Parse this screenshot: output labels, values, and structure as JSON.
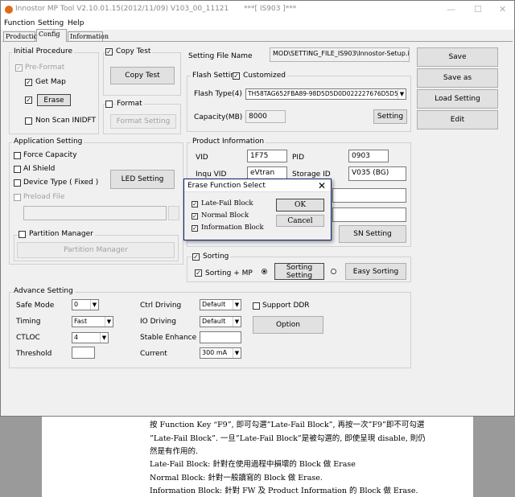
{
  "window": {
    "title": "Innostor MP Tool V2.10.01.15(2012/11/09)   V103_00_11121",
    "title_tag": "***[ IS903 ]***",
    "controls": [
      "—",
      "☐",
      "✕"
    ]
  },
  "menu": [
    "Function",
    "Setting",
    "Help"
  ],
  "tabs": [
    "Production",
    "Config",
    "Information"
  ],
  "initial_procedure": {
    "title": "Initial Procedure",
    "pre_format": "Pre-Format",
    "get_map": "Get Map",
    "erase_button": "Erase",
    "non_scan": "Non Scan INIDFT"
  },
  "copy_test": {
    "title": "Copy Test",
    "button": "Copy Test"
  },
  "format": {
    "title": "Format",
    "button": "Format Setting"
  },
  "setting_file": {
    "label": "Setting File Name",
    "value": "MOD\\SETTING_FILE_IS903\\Innostor-Setup.ini"
  },
  "right_buttons": [
    "Save",
    "Save as",
    "Load Setting",
    "Edit"
  ],
  "flash_setting": {
    "title": "Flash Setting",
    "customized": "Customized",
    "type_label": "Flash Type(4)",
    "type_value": "TH58TAG652FBA89-98D5D5D0D022227676D5D5",
    "capacity_label": "Capacity(MB)",
    "capacity_value": "8000",
    "setting_button": "Setting"
  },
  "application_setting": {
    "title": "Application Setting",
    "force_capacity": "Force Capacity",
    "ai_shield": "AI Shield",
    "device_type": "Device Type ( Fixed )",
    "led_button": "LED Setting",
    "preload_file": "Preload File",
    "partition_manager": "Partition Manager",
    "partition_button": "Partition Manager"
  },
  "product_info": {
    "title": "Product Information",
    "vid_label": "VID",
    "vid_value": "1F75",
    "pid_label": "PID",
    "pid_value": "0903",
    "inqu_label": "Inqu VID",
    "inqu_value": "eVtran",
    "storage_label": "Storage ID",
    "storage_value": "V035 (BG)",
    "sn_button": "SN Setting"
  },
  "sorting": {
    "title": "Sorting",
    "sorting_mp": "Sorting + MP",
    "sorting_setting": "Sorting Setting",
    "easy_sorting": "Easy Sorting"
  },
  "advance": {
    "title": "Advance Setting",
    "safe_mode_label": "Safe Mode",
    "safe_mode_value": "0",
    "timing_label": "Timing",
    "timing_value": "Fast",
    "ctloc_label": "CTLOC",
    "ctloc_value": "4",
    "threshold_label": "Threshold",
    "ctrl_driving_label": "Ctrl Driving",
    "ctrl_driving_value": "Default",
    "io_driving_label": "IO Driving",
    "io_driving_value": "Default",
    "stable_label": "Stable Enhance",
    "current_label": "Current",
    "current_value": "300 mA",
    "support_ddr": "Support DDR",
    "option_button": "Option"
  },
  "dialog": {
    "title": "Erase Function Select",
    "close": "✕",
    "items": [
      "Late-Fail Block",
      "Normal Block",
      "Information Block"
    ],
    "ok": "OK",
    "cancel": "Cancel"
  },
  "document": {
    "lines": [
      "按 Function Key “F9”, 即可勾選”Late-Fail Block”, 再按一次”F9”即不可勾選",
      "”Late-Fail Block”. 一旦”Late-Fail Block”是被勾選的, 即使呈現 disable, 則仍",
      "然是有作用的.",
      "Late-Fail Block: 針對在使用過程中損壞的 Block 做 Erase",
      "Normal Block: 針對一般讀寫的 Block 做 Erase.",
      "Information Block: 針對 FW 及 Product Information 的 Block 做 Erase."
    ]
  }
}
